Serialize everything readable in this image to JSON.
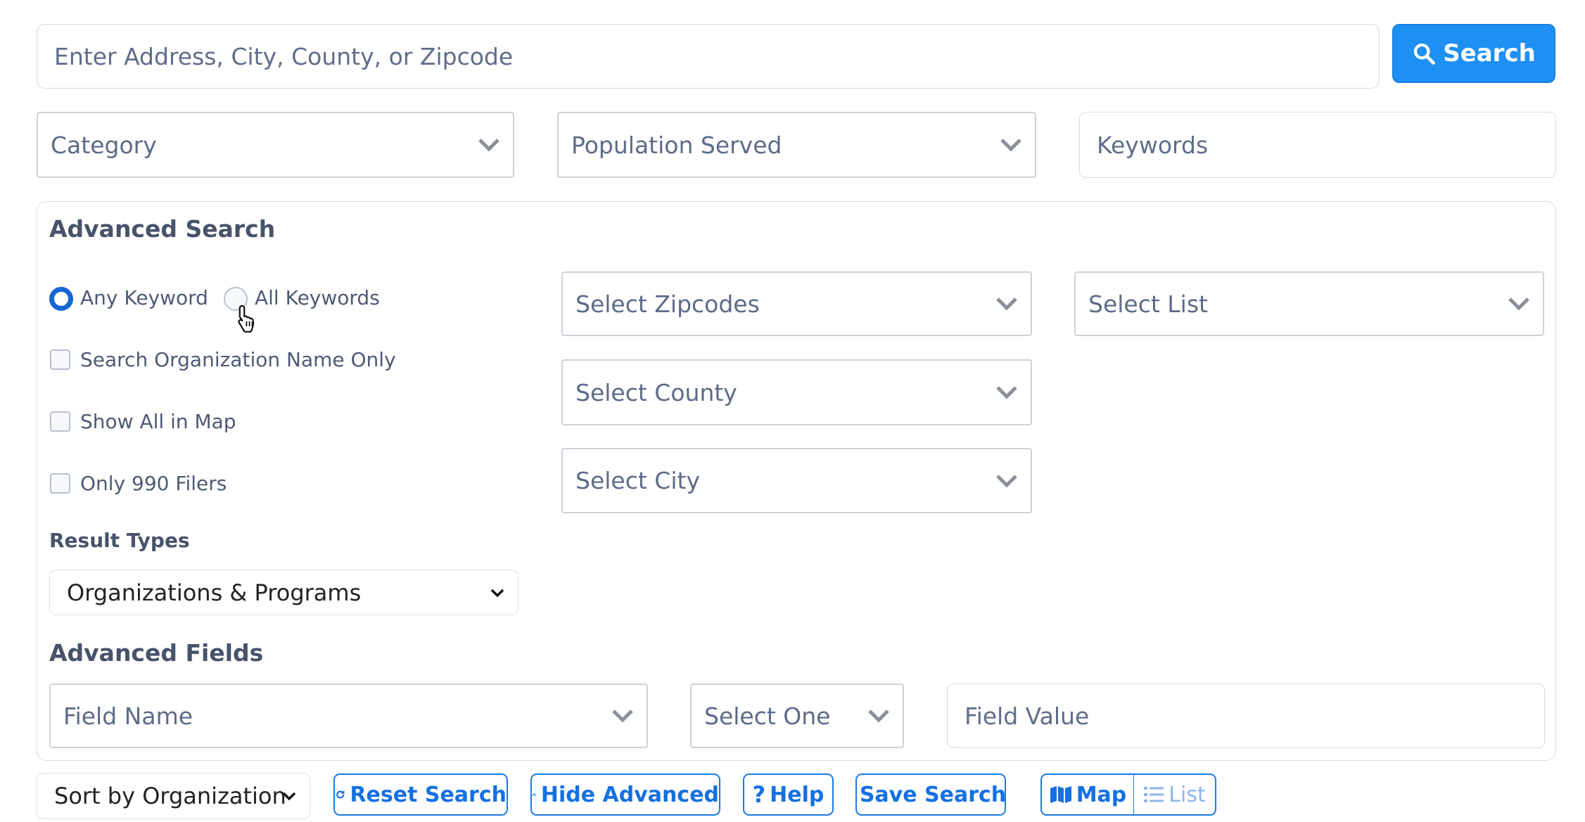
{
  "search": {
    "location_placeholder": "Enter Address, City, County, or Zipcode",
    "button_label": "Search"
  },
  "filters": {
    "category": "Category",
    "population": "Population Served",
    "keywords_placeholder": "Keywords"
  },
  "advanced": {
    "title": "Advanced Search",
    "any_keyword": "Any Keyword",
    "all_keywords": "All Keywords",
    "selected_mode": "Any Keyword",
    "org_name_only": "Search Organization Name Only",
    "show_all_map": "Show All in Map",
    "only_990": "Only 990 Filers",
    "zipcodes": "Select Zipcodes",
    "county": "Select County",
    "city": "Select City",
    "list": "Select List",
    "result_types_title": "Result Types",
    "result_types_value": "Organizations & Programs",
    "fields_title": "Advanced Fields",
    "field_name": "Field Name",
    "operator": "Select One",
    "field_value_placeholder": "Field Value"
  },
  "toolbar": {
    "sort_value": "Sort by Organization",
    "reset": "Reset Search",
    "hide_advanced": "Hide Advanced",
    "help": "Help",
    "save": "Save Search",
    "map": "Map",
    "list": "List"
  },
  "colors": {
    "primary": "#1e90f4",
    "outline": "#1e78e6",
    "radio_on": "#1565d8"
  },
  "icons": [
    "search-icon",
    "chevron-down-icon",
    "pointer-cursor-icon",
    "redo-icon",
    "chevron-up-icon",
    "question-icon",
    "save-icon",
    "map-icon",
    "list-icon"
  ]
}
